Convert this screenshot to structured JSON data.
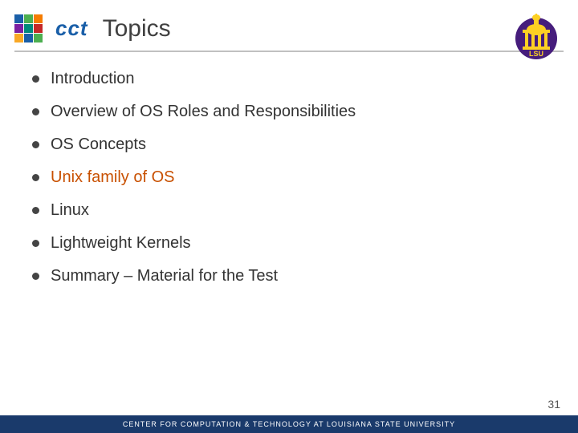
{
  "header": {
    "logo_text": "cct",
    "title": "Topics"
  },
  "bullets": [
    {
      "text": "Introduction",
      "highlight": false
    },
    {
      "text": "Overview of OS Roles and Responsibilities",
      "highlight": false
    },
    {
      "text": "OS Concepts",
      "highlight": false
    },
    {
      "text": "Unix family of OS",
      "highlight": true
    },
    {
      "text": "Linux",
      "highlight": false
    },
    {
      "text": "Lightweight Kernels",
      "highlight": false
    },
    {
      "text": "Summary – Material for the Test",
      "highlight": false
    }
  ],
  "page_number": "31",
  "footer_text": "Center for Computation & Technology at Louisiana State University",
  "colors": {
    "highlight": "#c85000",
    "normal": "#333333",
    "accent": "#1a3a6b"
  }
}
